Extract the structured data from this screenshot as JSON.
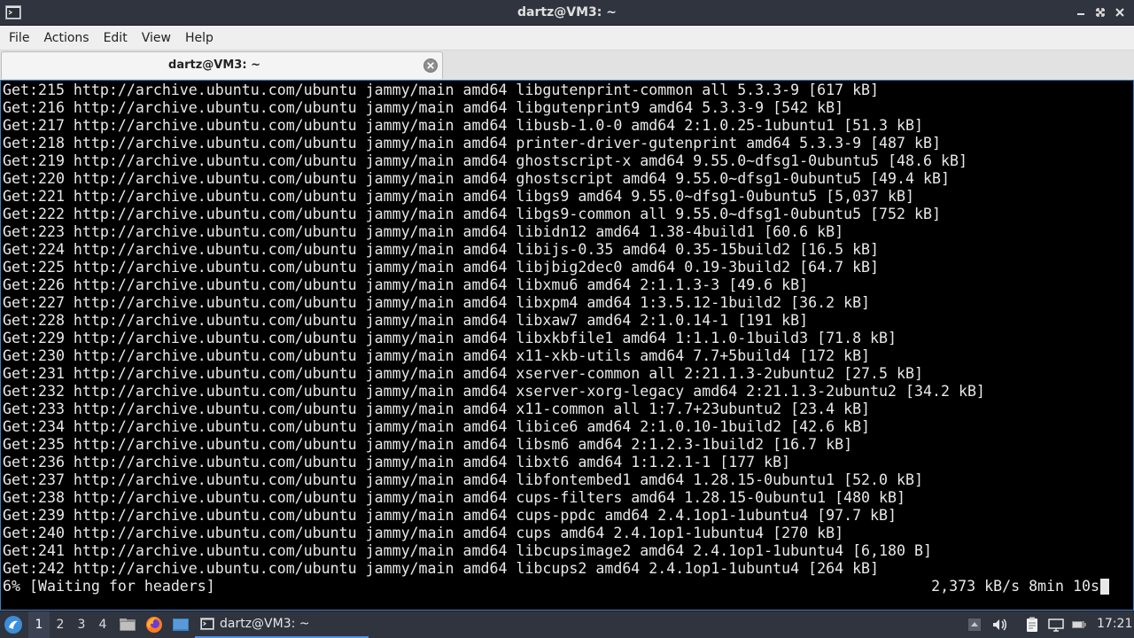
{
  "window": {
    "title": "dartz@VM3: ~"
  },
  "menu": [
    "File",
    "Actions",
    "Edit",
    "View",
    "Help"
  ],
  "tab": {
    "label": "dartz@VM3: ~"
  },
  "terminal": {
    "lines": [
      "Get:215 http://archive.ubuntu.com/ubuntu jammy/main amd64 libgutenprint-common all 5.3.3-9 [617 kB]",
      "Get:216 http://archive.ubuntu.com/ubuntu jammy/main amd64 libgutenprint9 amd64 5.3.3-9 [542 kB]",
      "Get:217 http://archive.ubuntu.com/ubuntu jammy/main amd64 libusb-1.0-0 amd64 2:1.0.25-1ubuntu1 [51.3 kB]",
      "Get:218 http://archive.ubuntu.com/ubuntu jammy/main amd64 printer-driver-gutenprint amd64 5.3.3-9 [487 kB]",
      "Get:219 http://archive.ubuntu.com/ubuntu jammy/main amd64 ghostscript-x amd64 9.55.0~dfsg1-0ubuntu5 [48.6 kB]",
      "Get:220 http://archive.ubuntu.com/ubuntu jammy/main amd64 ghostscript amd64 9.55.0~dfsg1-0ubuntu5 [49.4 kB]",
      "Get:221 http://archive.ubuntu.com/ubuntu jammy/main amd64 libgs9 amd64 9.55.0~dfsg1-0ubuntu5 [5,037 kB]",
      "Get:222 http://archive.ubuntu.com/ubuntu jammy/main amd64 libgs9-common all 9.55.0~dfsg1-0ubuntu5 [752 kB]",
      "Get:223 http://archive.ubuntu.com/ubuntu jammy/main amd64 libidn12 amd64 1.38-4build1 [60.6 kB]",
      "Get:224 http://archive.ubuntu.com/ubuntu jammy/main amd64 libijs-0.35 amd64 0.35-15build2 [16.5 kB]",
      "Get:225 http://archive.ubuntu.com/ubuntu jammy/main amd64 libjbig2dec0 amd64 0.19-3build2 [64.7 kB]",
      "Get:226 http://archive.ubuntu.com/ubuntu jammy/main amd64 libxmu6 amd64 2:1.1.3-3 [49.6 kB]",
      "Get:227 http://archive.ubuntu.com/ubuntu jammy/main amd64 libxpm4 amd64 1:3.5.12-1build2 [36.2 kB]",
      "Get:228 http://archive.ubuntu.com/ubuntu jammy/main amd64 libxaw7 amd64 2:1.0.14-1 [191 kB]",
      "Get:229 http://archive.ubuntu.com/ubuntu jammy/main amd64 libxkbfile1 amd64 1:1.1.0-1build3 [71.8 kB]",
      "Get:230 http://archive.ubuntu.com/ubuntu jammy/main amd64 x11-xkb-utils amd64 7.7+5build4 [172 kB]",
      "Get:231 http://archive.ubuntu.com/ubuntu jammy/main amd64 xserver-common all 2:21.1.3-2ubuntu2 [27.5 kB]",
      "Get:232 http://archive.ubuntu.com/ubuntu jammy/main amd64 xserver-xorg-legacy amd64 2:21.1.3-2ubuntu2 [34.2 kB]",
      "Get:233 http://archive.ubuntu.com/ubuntu jammy/main amd64 x11-common all 1:7.7+23ubuntu2 [23.4 kB]",
      "Get:234 http://archive.ubuntu.com/ubuntu jammy/main amd64 libice6 amd64 2:1.0.10-1build2 [42.6 kB]",
      "Get:235 http://archive.ubuntu.com/ubuntu jammy/main amd64 libsm6 amd64 2:1.2.3-1build2 [16.7 kB]",
      "Get:236 http://archive.ubuntu.com/ubuntu jammy/main amd64 libxt6 amd64 1:1.2.1-1 [177 kB]",
      "Get:237 http://archive.ubuntu.com/ubuntu jammy/main amd64 libfontembed1 amd64 1.28.15-0ubuntu1 [52.0 kB]",
      "Get:238 http://archive.ubuntu.com/ubuntu jammy/main amd64 cups-filters amd64 1.28.15-0ubuntu1 [480 kB]",
      "Get:239 http://archive.ubuntu.com/ubuntu jammy/main amd64 cups-ppdc amd64 2.4.1op1-1ubuntu4 [97.7 kB]",
      "Get:240 http://archive.ubuntu.com/ubuntu jammy/main amd64 cups amd64 2.4.1op1-1ubuntu4 [270 kB]",
      "Get:241 http://archive.ubuntu.com/ubuntu jammy/main amd64 libcupsimage2 amd64 2.4.1op1-1ubuntu4 [6,180 B]",
      "Get:242 http://archive.ubuntu.com/ubuntu jammy/main amd64 libcups2 amd64 2.4.1op1-1ubuntu4 [264 kB]",
      "6% [Waiting for headers]"
    ],
    "status_right": "2,373 kB/s 8min 10s"
  },
  "taskbar": {
    "workspaces": [
      "1",
      "2",
      "3",
      "4"
    ],
    "active_workspace": "1",
    "task_label": "dartz@VM3: ~",
    "clock": "17:21"
  },
  "colors": {
    "accent": "#5294e2",
    "terminal_bg": "#000000",
    "terminal_fg": "#e8e8e8"
  }
}
